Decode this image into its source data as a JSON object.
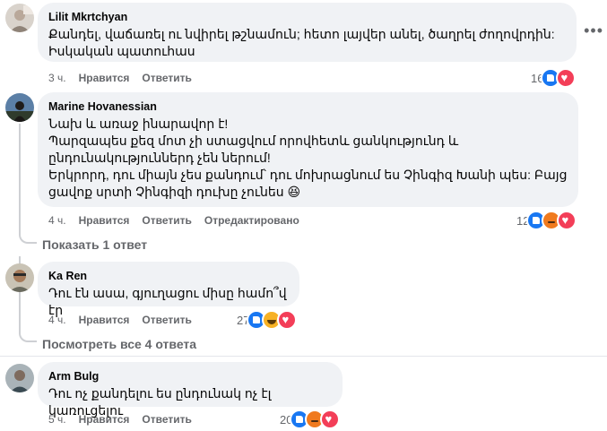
{
  "comments": [
    {
      "author": "Lilit Mkrtchyan",
      "text": "Քանդել, վաճառել ու նվիրել թշնամուն; հետո լայվեր անել, ծաղրել ժողովրդին:\nԻսկական պատուհաս",
      "time": "3 ч.",
      "like_label": "Нравится",
      "reply_label": "Ответить",
      "edited_label": "",
      "reaction_count": "16",
      "reactions": [
        "like",
        "love"
      ]
    },
    {
      "author": "Marine Hovanessian",
      "text": "Նախ և առաջ ինարավոր է!\nՊարզապես քեզ մոտ չի ստացվում որովհետև ցանկությունդ և\nընդունակություններդ չեն ներում!\nԵրկրորդ, դու միայն չես քանդում՝ դու մոխրացնում ես Չինգիզ Խանի պես: Բայց\nցավոք սրտի Չինգիզի դուխը չունես 😆",
      "time": "4 ч.",
      "like_label": "Нравится",
      "reply_label": "Ответить",
      "edited_label": "Отредактировано",
      "reaction_count": "12",
      "reactions": [
        "like",
        "angry",
        "love"
      ]
    },
    {
      "author": "Ka Ren",
      "text": "Դու էն ասա, գյուղացու միսը համո՞վ էր",
      "time": "4 ч.",
      "like_label": "Нравится",
      "reply_label": "Ответить",
      "edited_label": "",
      "reaction_count": "27",
      "reactions": [
        "like",
        "haha",
        "love"
      ]
    },
    {
      "author": "Arm Bulg",
      "text": "Դու ոչ քանդելու ես ընդունակ ոչ էլ կառուցելու",
      "time": "5 ч.",
      "like_label": "Нравится",
      "reply_label": "Ответить",
      "edited_label": "",
      "reaction_count": "20",
      "reactions": [
        "like",
        "angry",
        "love"
      ]
    }
  ],
  "show_reply_label": "Показать 1 ответ",
  "view_all_replies_label": "Посмотреть все 4 ответа",
  "icons": {
    "more": "more-options-icon",
    "like": "like-reaction-icon",
    "love": "love-reaction-icon",
    "angry": "angry-reaction-icon",
    "haha": "haha-reaction-icon"
  },
  "colors": {
    "bubble": "#f0f2f5",
    "meta": "#65676b",
    "like": "#1877f2",
    "love": "#f33e58"
  }
}
